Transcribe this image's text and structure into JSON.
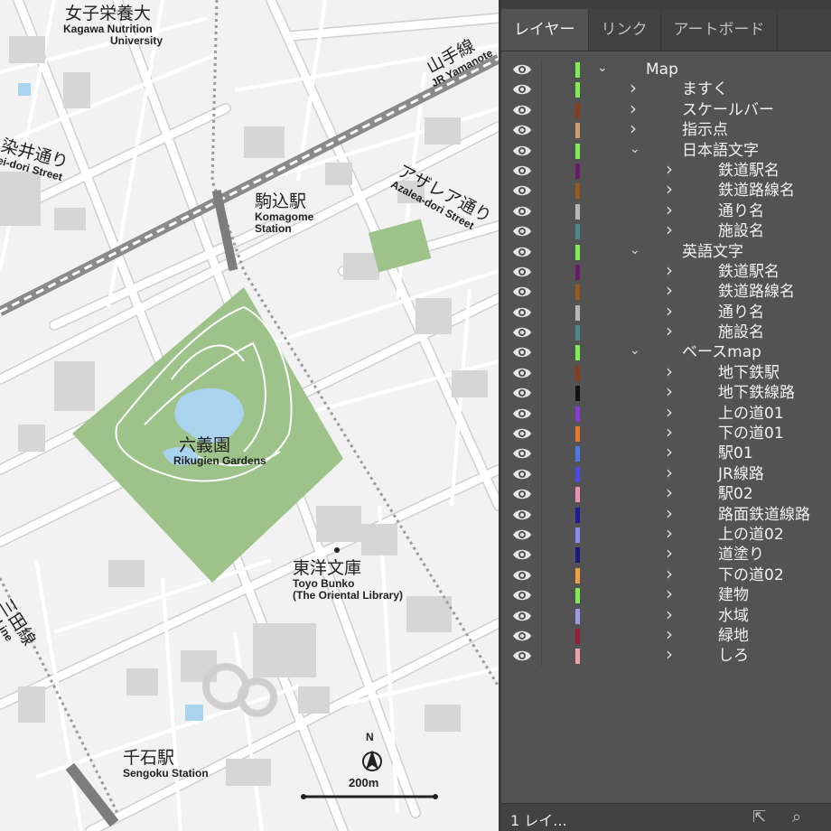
{
  "labels": {
    "kagawa": {
      "ja": "女子栄養大",
      "en1": "Kagawa Nutrition",
      "en2": "University"
    },
    "yamanote": {
      "ja": "山手線",
      "en": "JR Yamanote"
    },
    "somei": {
      "ja": "染井通り",
      "en": "ei-dori Street"
    },
    "azalea": {
      "ja": "アザレア通り",
      "en": "Azalea-dori Street"
    },
    "komagome": {
      "ja": "駒込駅",
      "en1": "Komagome",
      "en2": "Station"
    },
    "rikugien": {
      "ja": "六義園",
      "en": "Rikugien Gardens"
    },
    "toyo": {
      "ja": "東洋文庫",
      "en1": "Toyo Bunko",
      "en2": "(The Oriental Library)"
    },
    "mita": {
      "ja": "三田線",
      "en": "Subway Line"
    },
    "sengoku": {
      "ja": "千石駅",
      "en": "Sengoku Station"
    },
    "north": "N",
    "scale": "200m"
  },
  "panel": {
    "tabs": [
      {
        "label": "レイヤー",
        "active": true
      },
      {
        "label": "リンク",
        "active": false
      },
      {
        "label": "アートボード",
        "active": false
      }
    ],
    "layers": [
      {
        "name": "Map",
        "color": "#7cf052",
        "depth": 0,
        "expanded": true
      },
      {
        "name": "ますく",
        "color": "#7cf052",
        "depth": 1,
        "expanded": false
      },
      {
        "name": "スケールバー",
        "color": "#8b3a1c",
        "depth": 1,
        "expanded": false
      },
      {
        "name": "指示点",
        "color": "#d09a6a",
        "depth": 1,
        "expanded": false
      },
      {
        "name": "日本語文字",
        "color": "#7cf052",
        "depth": 1,
        "expanded": true
      },
      {
        "name": "鉄道駅名",
        "color": "#6a1a6a",
        "depth": 2,
        "expanded": false
      },
      {
        "name": "鉄道路線名",
        "color": "#9a5a1c",
        "depth": 2,
        "expanded": false
      },
      {
        "name": "通り名",
        "color": "#b8b8b8",
        "depth": 2,
        "expanded": false
      },
      {
        "name": "施設名",
        "color": "#4a8a8a",
        "depth": 2,
        "expanded": false
      },
      {
        "name": "英語文字",
        "color": "#7cf052",
        "depth": 1,
        "expanded": true
      },
      {
        "name": "鉄道駅名",
        "color": "#6a1a6a",
        "depth": 2,
        "expanded": false
      },
      {
        "name": "鉄道路線名",
        "color": "#9a5a1c",
        "depth": 2,
        "expanded": false
      },
      {
        "name": "通り名",
        "color": "#b8b8b8",
        "depth": 2,
        "expanded": false
      },
      {
        "name": "施設名",
        "color": "#4a8a8a",
        "depth": 2,
        "expanded": false
      },
      {
        "name": "ベースmap",
        "color": "#7cf052",
        "depth": 1,
        "expanded": true
      },
      {
        "name": "地下鉄駅",
        "color": "#8b3a1c",
        "depth": 2,
        "expanded": false
      },
      {
        "name": "地下鉄線路",
        "color": "#111111",
        "depth": 2,
        "expanded": false
      },
      {
        "name": "上の道01",
        "color": "#8a3ad8",
        "depth": 2,
        "expanded": false
      },
      {
        "name": "下の道01",
        "color": "#e8732a",
        "depth": 2,
        "expanded": false
      },
      {
        "name": "駅01",
        "color": "#4a7ae8",
        "depth": 2,
        "expanded": false
      },
      {
        "name": "JR線路",
        "color": "#4a4ae8",
        "depth": 2,
        "expanded": false
      },
      {
        "name": "駅02",
        "color": "#f090b8",
        "depth": 2,
        "expanded": false
      },
      {
        "name": "路面鉄道線路",
        "color": "#1a1a9a",
        "depth": 2,
        "expanded": false
      },
      {
        "name": "上の道02",
        "color": "#8a8ae8",
        "depth": 2,
        "expanded": false
      },
      {
        "name": "道塗り",
        "color": "#1a1a7a",
        "depth": 2,
        "expanded": false
      },
      {
        "name": "下の道02",
        "color": "#f0a040",
        "depth": 2,
        "expanded": false
      },
      {
        "name": "建物",
        "color": "#7cf052",
        "depth": 2,
        "expanded": false
      },
      {
        "name": "水域",
        "color": "#9a9ae8",
        "depth": 2,
        "expanded": false
      },
      {
        "name": "緑地",
        "color": "#9a1a3a",
        "depth": 2,
        "expanded": false
      },
      {
        "name": "しろ",
        "color": "#f0a0a8",
        "depth": 2,
        "expanded": false
      }
    ],
    "footer_count": "1 レイ..."
  }
}
